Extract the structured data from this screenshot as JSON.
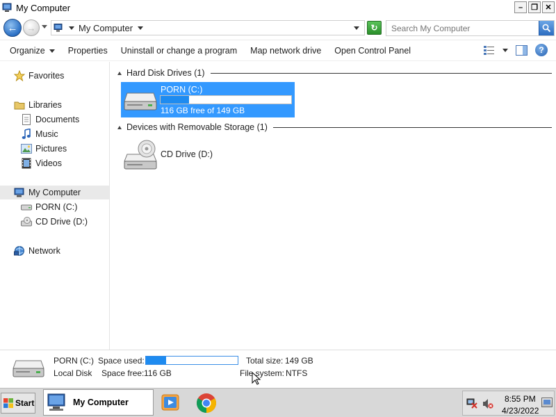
{
  "window": {
    "title": "My Computer",
    "minimize_label": "–",
    "maximize_label": "❐",
    "close_label": "✕"
  },
  "address": {
    "crumb": "My Computer",
    "search_placeholder": "Search My Computer"
  },
  "toolbar": {
    "organize": "Organize",
    "properties": "Properties",
    "uninstall": "Uninstall or change a program",
    "map_drive": "Map network drive",
    "control_panel": "Open Control Panel",
    "help": "?"
  },
  "nav": {
    "favorites": "Favorites",
    "libraries": "Libraries",
    "documents": "Documents",
    "music": "Music",
    "pictures": "Pictures",
    "videos": "Videos",
    "my_computer": "My Computer",
    "drive_c": "PORN (C:)",
    "drive_d": "CD Drive (D:)",
    "network": "Network"
  },
  "content": {
    "group_hdd": "Hard Disk Drives (1)",
    "group_removable": "Devices with Removable Storage (1)",
    "drive_c": {
      "name": "PORN (C:)",
      "free_text": "116 GB free of 149 GB",
      "used_fraction": 0.22
    },
    "drive_d": {
      "name": "CD Drive (D:)"
    }
  },
  "details": {
    "name": "PORN (C:)",
    "type": "Local Disk",
    "space_used_label": "Space used:",
    "space_free_label": "Space free:",
    "space_free_value": "116 GB",
    "total_size_label": "Total size:",
    "total_size_value": "149 GB",
    "file_system_label": "File system:",
    "file_system_value": "NTFS"
  },
  "taskbar": {
    "start": "Start",
    "active_window": "My Computer",
    "time": "8:55 PM",
    "date": "4/23/2022"
  },
  "colors": {
    "selection": "#3399ff",
    "usage_fill": "#1e8bf0"
  },
  "icons": [
    "computer-icon",
    "back-arrow-icon",
    "forward-arrow-icon",
    "refresh-icon",
    "search-icon",
    "views-icon",
    "preview-pane-icon",
    "help-icon",
    "star-icon",
    "folder-icon",
    "document-icon",
    "music-note-icon",
    "picture-icon",
    "film-icon",
    "hard-drive-icon",
    "cd-drive-icon",
    "network-icon",
    "windows-flag-icon",
    "media-player-icon",
    "chrome-icon",
    "network-disconnected-icon",
    "speaker-muted-icon"
  ]
}
